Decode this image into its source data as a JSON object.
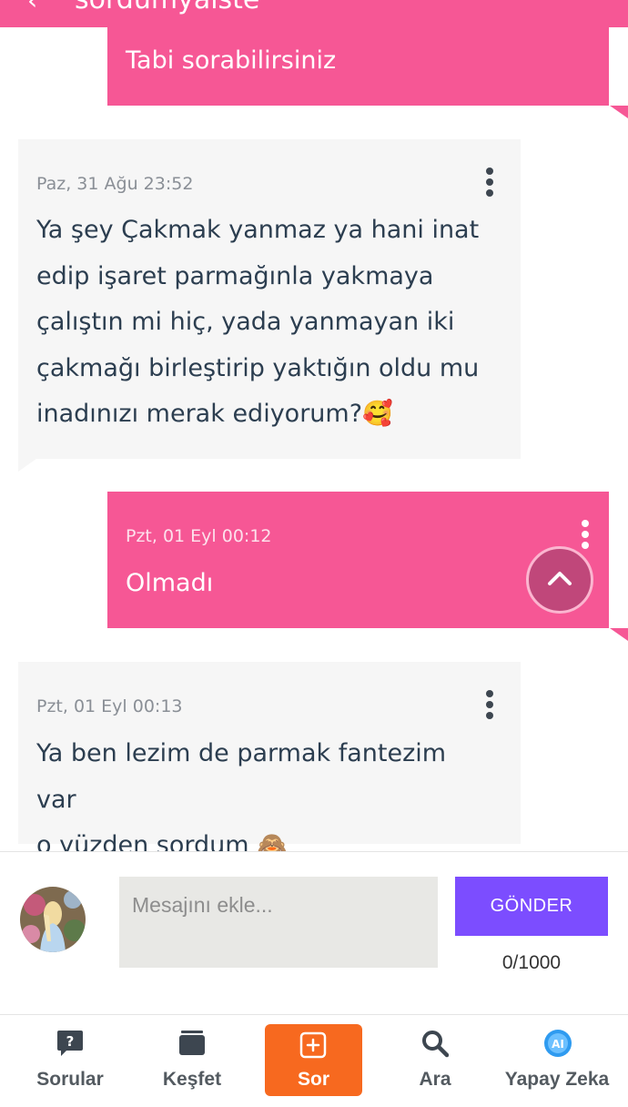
{
  "header": {
    "title": "sordumyalste",
    "back_icon": "chevron-left-icon"
  },
  "messages": [
    {
      "side": "mine",
      "time": "",
      "text": "Tabi sorabilirsiniz"
    },
    {
      "side": "theirs",
      "time": "Paz, 31 Ağu 23:52",
      "lines": [
        "Ya şey Çakmak yanmaz ya hani inat",
        "edip işaret parmağınla yakmaya",
        "çalıştın mi hiç, yada yanmayan iki",
        "çakmağı birleştirip yaktığın oldu mu",
        "inadınızı merak ediyorum?🥰"
      ]
    },
    {
      "side": "mine",
      "time": "Pzt, 01 Eyl 00:12",
      "text": "Olmadı"
    },
    {
      "side": "theirs",
      "time": "Pzt, 01 Eyl 00:13",
      "lines": [
        "Ya ben lezim de parmak fantezim var",
        "o yüzden sordum 🙈"
      ]
    }
  ],
  "composer": {
    "placeholder": "Mesajını ekle...",
    "send_label": "GÖNDER",
    "counter": "0/1000"
  },
  "nav": {
    "items": [
      {
        "label": "Sorular",
        "icon": "question-bubble-icon"
      },
      {
        "label": "Keşfet",
        "icon": "cards-stack-icon"
      },
      {
        "label": "Sor",
        "icon": "plus-square-icon",
        "active": true
      },
      {
        "label": "Ara",
        "icon": "search-icon"
      },
      {
        "label": "Yapay Zeka",
        "icon": "ai-badge-icon"
      }
    ]
  },
  "colors": {
    "accent_pink": "#f65795",
    "send_purple": "#7c4dff",
    "active_orange": "#f7691f",
    "bubble_grey": "#f6f6f6"
  }
}
